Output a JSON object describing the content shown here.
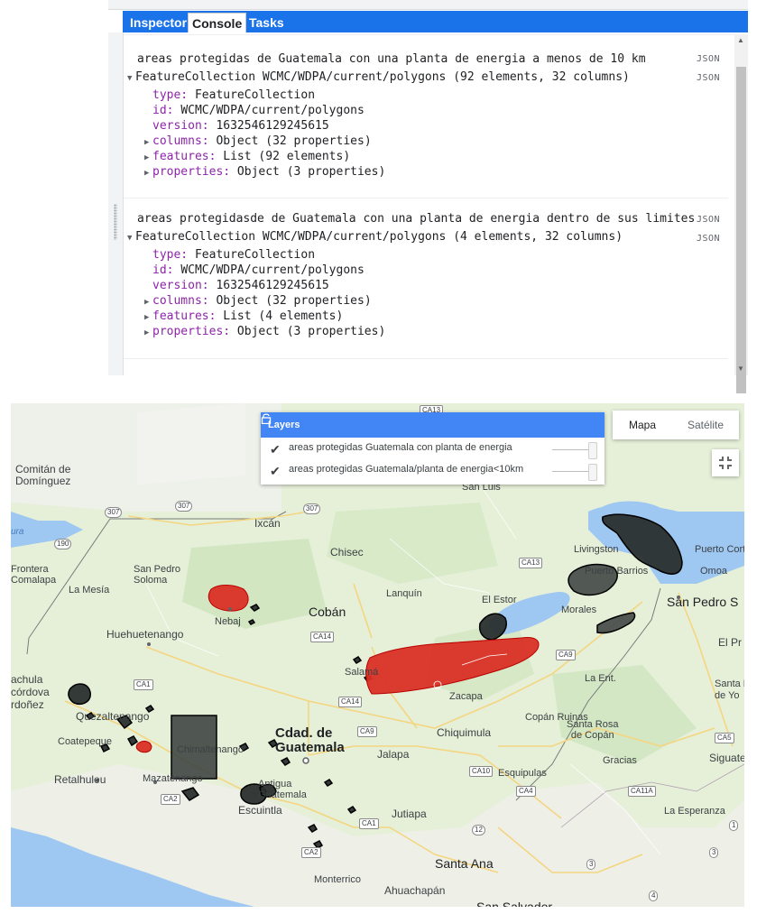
{
  "tabs": [
    {
      "label": "Inspector",
      "active": false
    },
    {
      "label": "Console",
      "active": true
    },
    {
      "label": "Tasks",
      "active": false
    }
  ],
  "entries": [
    {
      "message": "areas protegidas de Guatemala con una planta de energia a menos de 10 km",
      "json_label_1": "JSON",
      "summary": "FeatureCollection WCMC/WDPA/current/polygons (92 elements, 32 columns)",
      "json_label_2": "JSON",
      "type_key": "type:",
      "type_val": "FeatureCollection",
      "id_key": "id:",
      "id_val": "WCMC/WDPA/current/polygons",
      "version_key": "version:",
      "version_val": "1632546129245615",
      "columns_key": "columns:",
      "columns_val": "Object (32 properties)",
      "features_key": "features:",
      "features_val": "List (92 elements)",
      "properties_key": "properties:",
      "properties_val": "Object (3 properties)"
    },
    {
      "message": "areas protegidasde de Guatemala con una planta de energia dentro de sus limites",
      "json_label_1": "JSON",
      "summary": "FeatureCollection WCMC/WDPA/current/polygons (4 elements, 32 columns)",
      "json_label_2": "JSON",
      "type_key": "type:",
      "type_val": "FeatureCollection",
      "id_key": "id:",
      "id_val": "WCMC/WDPA/current/polygons",
      "version_key": "version:",
      "version_val": "1632546129245615",
      "columns_key": "columns:",
      "columns_val": "Object (32 properties)",
      "features_key": "features:",
      "features_val": "List (4 elements)",
      "properties_key": "properties:",
      "properties_val": "Object (3 properties)"
    }
  ],
  "map": {
    "layers_title": "Layers",
    "layers": [
      {
        "label": "areas protegidas Guatemala con planta de energia",
        "checked": true,
        "opacity": 1.0
      },
      {
        "label": "areas protegidas Guatemala/planta de energia<10km",
        "checked": true,
        "opacity": 1.0
      }
    ],
    "map_type_map": "Mapa",
    "map_type_satellite": "Satélite",
    "labels": {
      "comitan": "Comitán de\nDomínguez",
      "ixcan": "Ixcán",
      "chisec": "Chisec",
      "frontera": "Frontera\nComalapa",
      "san_pedro_soloma": "San Pedro\nSoloma",
      "la_mesia": "La Mesía",
      "nebaj": "Nebaj",
      "languin": "Lanquín",
      "coban": "Cobán",
      "el_estor": "El Estor",
      "livingston": "Livingston",
      "puerto_barrios": "Puerto Barrios",
      "puerto_cortes": "Puerto Cortés",
      "omoa": "Omoa",
      "san_pedro_sula": "San Pedro S",
      "morales": "Morales",
      "huehuetenango": "Huehuetenango",
      "el_p": "El Pr",
      "salama": "Salamá",
      "la_ent": "La Ent.",
      "santa_r": "Santa R\nde Yo",
      "tapachula": "achula\ncórdova\nrdoñez",
      "quetzaltenango": "Quezaltenango",
      "zacapa": "Zacapa",
      "cdad_guatemala": "Cdad. de\nGuatemala",
      "chiquimula": "Chiquimula",
      "copan_ruinas": "Copán Ruinas",
      "santa_rosa_copan": "Santa Rosa\nde Copán",
      "coatepeque": "Coatepeque",
      "chimaltenango": "Chimaltenango",
      "jalapa": "Jalapa",
      "gracias": "Gracias",
      "siguatepeque": "Siguate",
      "retalhuleu": "Retalhuleu",
      "mazatenango": "Mazatenango",
      "antigua": "Antigua\nGuatemala",
      "esquipulas": "Esquipulas",
      "escuintla": "Escuintla",
      "jutiapa": "Jutiapa",
      "la_esperanza": "La Esperanza",
      "santa_ana": "Santa Ana",
      "monterrico": "Monterrico",
      "ahuachapan": "Ahuachapán",
      "san_salvador": "San Salvador",
      "san_luis": "San Luis",
      "golfo": "ura"
    },
    "roads": {
      "ca13_top": "CA13",
      "r307a": "307",
      "r307b": "307",
      "r307c": "307",
      "r190": "190",
      "ca13": "CA13",
      "ca14a": "CA14",
      "ca9a": "CA9",
      "ca1a": "CA1",
      "ca14b": "CA14",
      "ca9b": "CA9",
      "ca5": "CA5",
      "ca10": "CA10",
      "ca4": "CA4",
      "ca11a": "CA11A",
      "ca2a": "CA2",
      "ca1b": "CA1",
      "ca2b": "CA2",
      "r12": "12",
      "r3a": "3",
      "r3b": "3",
      "r4": "4",
      "r1": "1"
    },
    "colors": {
      "land": "#e6f0d9",
      "water": "#9ec7f2",
      "near_layer_fill": "#2a2f2e",
      "within_layer_fill": "#d93025",
      "header_blue": "#4285f4",
      "tab_blue": "#1a73e8"
    }
  }
}
